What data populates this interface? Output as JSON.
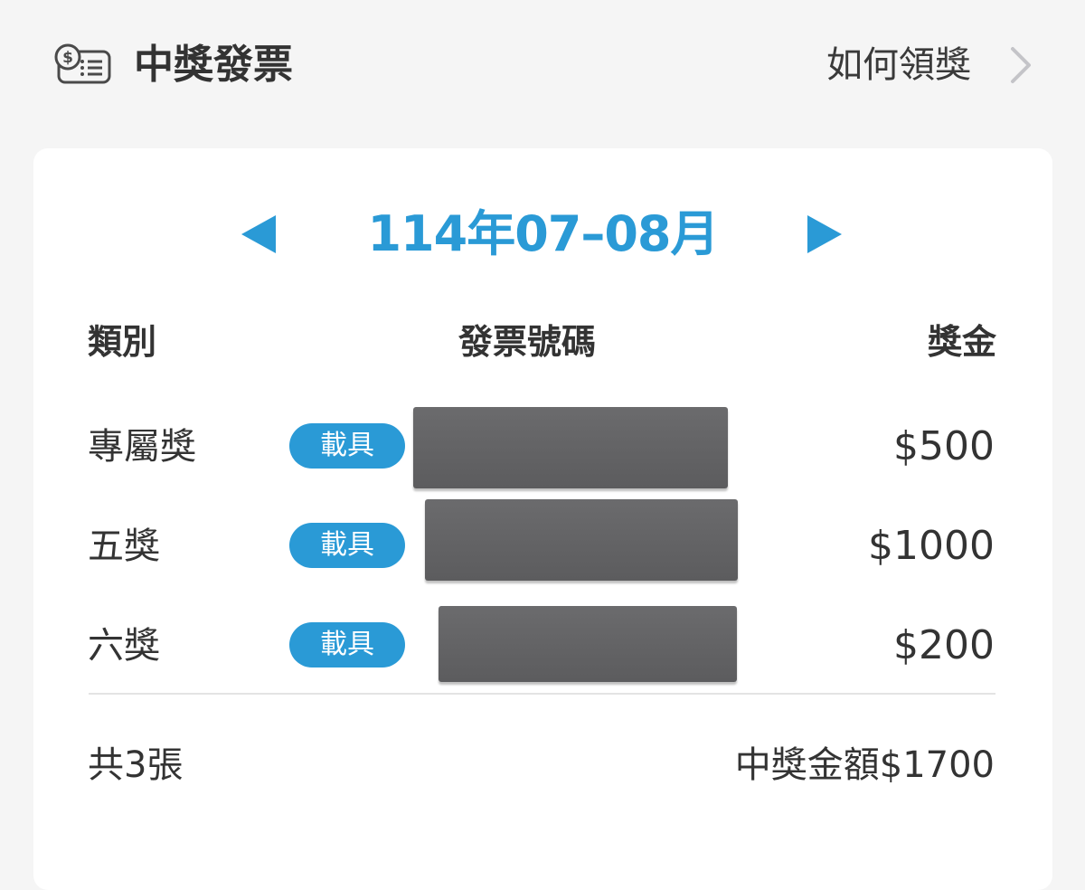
{
  "header": {
    "icon": "receipt-list-icon",
    "title": "中獎發票",
    "howto_label": "如何領獎",
    "howto_icon": "chevron-right-icon"
  },
  "period": {
    "label": "114年07–08月",
    "prev_icon": "triangle-left-icon",
    "next_icon": "triangle-right-icon"
  },
  "table": {
    "headers": {
      "category": "類別",
      "number": "發票號碼",
      "prize": "獎金"
    },
    "rows": [
      {
        "category": "專屬獎",
        "badge": "載具",
        "number": "",
        "prize": "$500"
      },
      {
        "category": "五獎",
        "badge": "載具",
        "number": "",
        "prize": "$1000"
      },
      {
        "category": "六獎",
        "badge": "載具",
        "number": "",
        "prize": "$200"
      }
    ]
  },
  "summary": {
    "count": "共3張",
    "total": "中獎金額$1700"
  },
  "colors": {
    "accent": "#2a9ad6",
    "background": "#f5f5f5",
    "card": "#ffffff",
    "redaction": "#636365"
  }
}
